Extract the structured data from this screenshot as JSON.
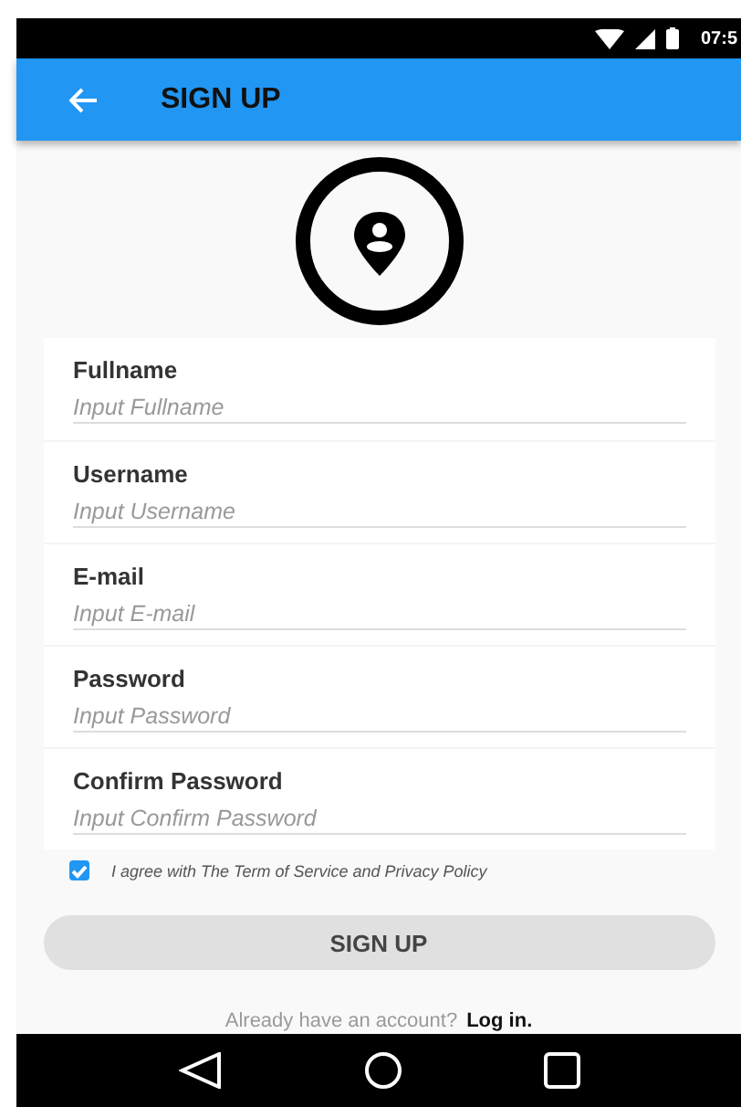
{
  "status_bar": {
    "time": "07:5"
  },
  "app_bar": {
    "title": "SIGN UP"
  },
  "fields": [
    {
      "label": "Fullname",
      "placeholder": "Input Fullname"
    },
    {
      "label": "Username",
      "placeholder": "Input Username"
    },
    {
      "label": "E-mail",
      "placeholder": "Input E-mail"
    },
    {
      "label": "Password",
      "placeholder": "Input Password"
    },
    {
      "label": "Confirm Password",
      "placeholder": "Input Confirm Password"
    }
  ],
  "agreement": {
    "text": "I agree with The Term of Service and Privacy Policy",
    "checked": true
  },
  "submit_button": "SIGN UP",
  "footer": {
    "text": "Already have an account?",
    "link": "Log in."
  }
}
